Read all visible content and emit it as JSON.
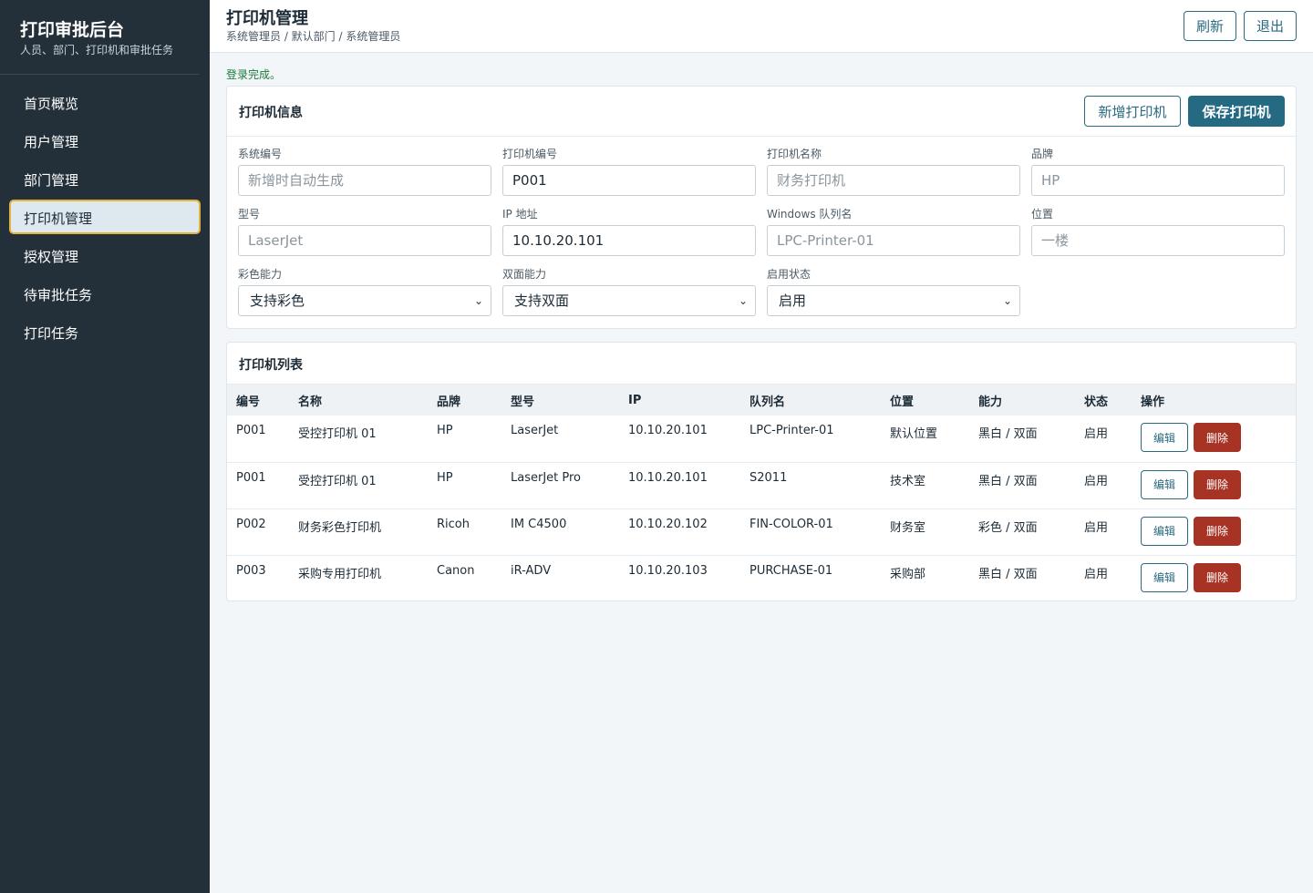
{
  "sidebar": {
    "brand_title": "打印审批后台",
    "brand_subtitle": "人员、部门、打印机和审批任务",
    "items": [
      {
        "label": "首页概览",
        "active": false
      },
      {
        "label": "用户管理",
        "active": false
      },
      {
        "label": "部门管理",
        "active": false
      },
      {
        "label": "打印机管理",
        "active": true
      },
      {
        "label": "授权管理",
        "active": false
      },
      {
        "label": "待审批任务",
        "active": false
      },
      {
        "label": "打印任务",
        "active": false
      }
    ]
  },
  "header": {
    "title": "打印机管理",
    "breadcrumb": "系统管理员 / 默认部门 / 系统管理员",
    "refresh_label": "刷新",
    "logout_label": "退出"
  },
  "status_message": "登录完成。",
  "printer_form": {
    "title": "打印机信息",
    "add_label": "新增打印机",
    "save_label": "保存打印机",
    "fields": {
      "system_id": {
        "label": "系统编号",
        "value": "",
        "placeholder": "新增时自动生成"
      },
      "printer_code": {
        "label": "打印机编号",
        "value": "P001",
        "placeholder": ""
      },
      "printer_name": {
        "label": "打印机名称",
        "value": "",
        "placeholder": "财务打印机"
      },
      "brand": {
        "label": "品牌",
        "value": "",
        "placeholder": "HP"
      },
      "model": {
        "label": "型号",
        "value": "",
        "placeholder": "LaserJet"
      },
      "ip": {
        "label": "IP 地址",
        "value": "10.10.20.101",
        "placeholder": ""
      },
      "queue": {
        "label": "Windows 队列名",
        "value": "",
        "placeholder": "LPC-Printer-01"
      },
      "location": {
        "label": "位置",
        "value": "",
        "placeholder": "一楼"
      },
      "color": {
        "label": "彩色能力",
        "value": "支持彩色"
      },
      "duplex": {
        "label": "双面能力",
        "value": "支持双面"
      },
      "enabled": {
        "label": "启用状态",
        "value": "启用"
      }
    }
  },
  "printer_list": {
    "title": "打印机列表",
    "columns": [
      "编号",
      "名称",
      "品牌",
      "型号",
      "IP",
      "队列名",
      "位置",
      "能力",
      "状态",
      "操作"
    ],
    "edit_label": "编辑",
    "delete_label": "删除",
    "rows": [
      {
        "code": "P001",
        "name": "受控打印机 01",
        "brand": "HP",
        "model": "LaserJet",
        "ip": "10.10.20.101",
        "queue": "LPC-Printer-01",
        "location": "默认位置",
        "ability": "黑白 / 双面",
        "status": "启用"
      },
      {
        "code": "P001",
        "name": "受控打印机 01",
        "brand": "HP",
        "model": "LaserJet Pro",
        "ip": "10.10.20.101",
        "queue": "S2011",
        "location": "技术室",
        "ability": "黑白 / 双面",
        "status": "启用"
      },
      {
        "code": "P002",
        "name": "财务彩色打印机",
        "brand": "Ricoh",
        "model": "IM C4500",
        "ip": "10.10.20.102",
        "queue": "FIN-COLOR-01",
        "location": "财务室",
        "ability": "彩色 / 双面",
        "status": "启用"
      },
      {
        "code": "P003",
        "name": "采购专用打印机",
        "brand": "Canon",
        "model": "iR-ADV",
        "ip": "10.10.20.103",
        "queue": "PURCHASE-01",
        "location": "采购部",
        "ability": "黑白 / 双面",
        "status": "启用"
      }
    ]
  },
  "colors": {
    "sidebar_bg": "#23303a",
    "accent": "#236a82",
    "danger": "#a63324",
    "active_border": "#e3b23c",
    "success_text": "#1d7a3d"
  }
}
